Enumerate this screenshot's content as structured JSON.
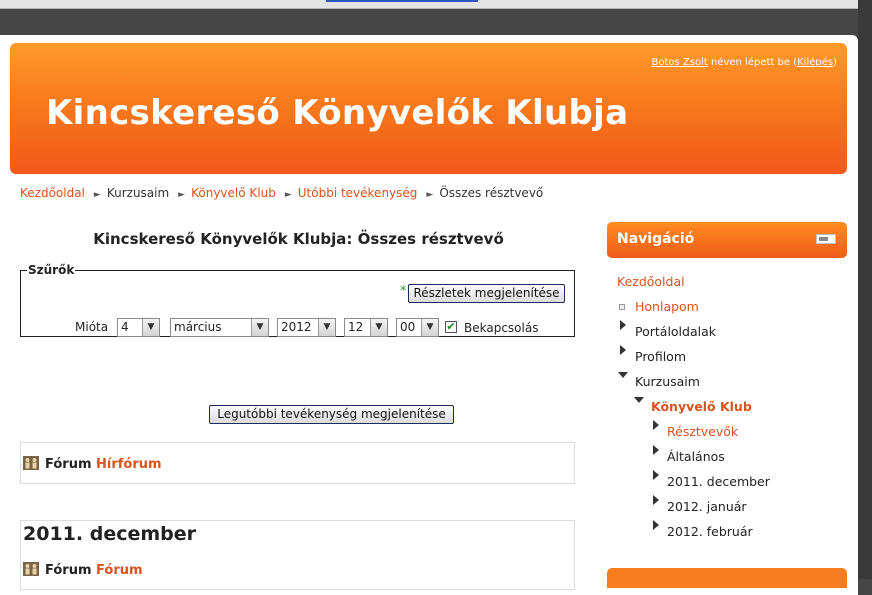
{
  "header": {
    "site_title": "Kincskereső Könyvelők Klubja",
    "login": {
      "user": "Botos Zsolt",
      "text": "néven lépett be",
      "paren_open": "(",
      "logout": "Kilépés",
      "paren_close": ")"
    }
  },
  "breadcrumb": [
    "Kezdőoldal",
    "Kurzusaim",
    "Könyvelő Klub",
    "Utóbbi tevékenység",
    "Összes résztvevő"
  ],
  "main": {
    "heading": "Kincskereső Könyvelők Klubja: Összes résztvevő",
    "filters": {
      "legend": "Szűrők",
      "required_marker": "*",
      "show_details": "Részletek megjelenítése",
      "since_label": "Mióta",
      "day": "4",
      "month": "március",
      "year": "2012",
      "hour": "12",
      "minute": "00",
      "enable_label": "Bekapcsolás",
      "enabled": true
    },
    "recent_button": "Legutóbbi tevékenység megjelenítése",
    "sections": [
      {
        "heading": "",
        "activities": [
          {
            "type": "Fórum",
            "name": "Hírfórum"
          }
        ]
      },
      {
        "heading": "2011. december",
        "activities": [
          {
            "type": "Fórum",
            "name": "Fórum"
          }
        ]
      }
    ]
  },
  "navigation": {
    "title": "Navigáció",
    "items": [
      {
        "label": "Kezdőoldal"
      },
      {
        "label": "Honlapom"
      },
      {
        "label": "Portáloldalak"
      },
      {
        "label": "Profilom"
      },
      {
        "label": "Kurzusaim"
      },
      {
        "label": "Könyvelő Klub"
      },
      {
        "label": "Résztvevők"
      },
      {
        "label": "Általános"
      },
      {
        "label": "2011. december"
      },
      {
        "label": "2012. január"
      },
      {
        "label": "2012. február"
      }
    ]
  },
  "colors": {
    "accent": "#f06a1c",
    "link": "#d9531e",
    "check": "#1f8a1f"
  }
}
